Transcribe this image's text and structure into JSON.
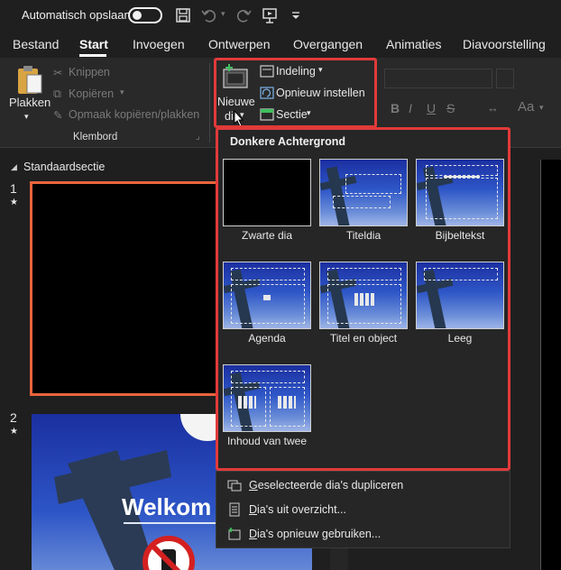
{
  "titlebar": {
    "autosave_label": "Automatisch opslaan",
    "autosave_state": "off"
  },
  "tabs": [
    "Bestand",
    "Start",
    "Invoegen",
    "Ontwerpen",
    "Overgangen",
    "Animaties",
    "Diavoorstelling"
  ],
  "active_tab": "Start",
  "ribbon": {
    "paste_label": "Plakken",
    "cut_label": "Knippen",
    "copy_label": "Kopiëren",
    "format_painter_label": "Opmaak kopiëren/plakken",
    "clipboard_group": "Klembord",
    "new_slide_line1": "Nieuwe",
    "new_slide_line2": "dia",
    "layout_label": "Indeling",
    "reset_label": "Opnieuw instellen",
    "section_label": "Sectie",
    "font_size_label": "Aa"
  },
  "slides_panel": {
    "section_name": "Standaardsectie",
    "slide1_number": "1",
    "slide2_number": "2",
    "slide2_title": "Welkom"
  },
  "gallery": {
    "heading": "Donkere Achtergrond",
    "layouts": [
      "Zwarte dia",
      "Titeldia",
      "Bijbeltekst",
      "Agenda",
      "Titel en object",
      "Leeg",
      "Inhoud van twee"
    ]
  },
  "menu": {
    "duplicate": "Geselecteerde dia's dupliceren",
    "from_outline": "Dia's uit overzicht...",
    "reuse": "Dia's opnieuw gebruiken..."
  },
  "colors": {
    "highlight": "#e23a3a",
    "selected_slide": "#e8643c",
    "accent_green": "#3fbf5f"
  }
}
